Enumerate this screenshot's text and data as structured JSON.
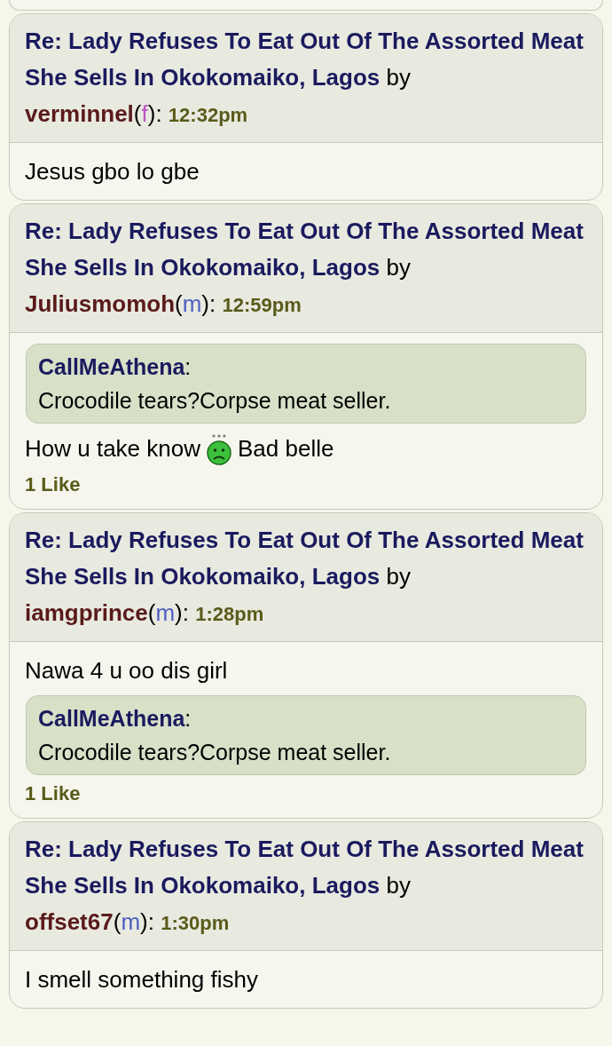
{
  "posts": [
    {
      "title": "Re: Lady Refuses To Eat Out Of The Assorted Meat She Sells In Okokomaiko, Lagos",
      "by": "by",
      "author": "verminnel",
      "gender_open": "(",
      "gender": "f",
      "gender_close": "):",
      "time": "12:32pm",
      "body": [
        {
          "kind": "text",
          "segments": [
            {
              "kind": "text",
              "text": "Jesus gbo lo gbe"
            }
          ]
        }
      ]
    },
    {
      "title": "Re: Lady Refuses To Eat Out Of The Assorted Meat She Sells In Okokomaiko, Lagos",
      "by": "by",
      "author": "Juliusmomoh",
      "gender_open": "(",
      "gender": "m",
      "gender_close": "):",
      "time": "12:59pm",
      "body": [
        {
          "kind": "quote",
          "author": "CallMeAthena",
          "colon": ":",
          "text": "Crocodile tears?Corpse meat seller."
        },
        {
          "kind": "text",
          "segments": [
            {
              "kind": "text",
              "text": "How u take know"
            },
            {
              "kind": "emoji"
            },
            {
              "kind": "text",
              "text": "Bad belle"
            }
          ]
        }
      ],
      "likes": "1 Like"
    },
    {
      "title": "Re: Lady Refuses To Eat Out Of The Assorted Meat She Sells In Okokomaiko, Lagos",
      "by": "by",
      "author": "iamgprince",
      "gender_open": "(",
      "gender": "m",
      "gender_close": "):",
      "time": "1:28pm",
      "body": [
        {
          "kind": "text",
          "segments": [
            {
              "kind": "text",
              "text": "Nawa 4 u oo dis girl"
            }
          ]
        },
        {
          "kind": "quote",
          "author": "CallMeAthena",
          "colon": ":",
          "text": "Crocodile tears?Corpse meat seller."
        }
      ],
      "likes": "1 Like"
    },
    {
      "title": "Re: Lady Refuses To Eat Out Of The Assorted Meat She Sells In Okokomaiko, Lagos",
      "by": "by",
      "author": "offset67",
      "gender_open": "(",
      "gender": "m",
      "gender_close": "):",
      "time": "1:30pm",
      "body": [
        {
          "kind": "text",
          "segments": [
            {
              "kind": "text",
              "text": "I smell something fishy"
            }
          ]
        }
      ]
    }
  ]
}
